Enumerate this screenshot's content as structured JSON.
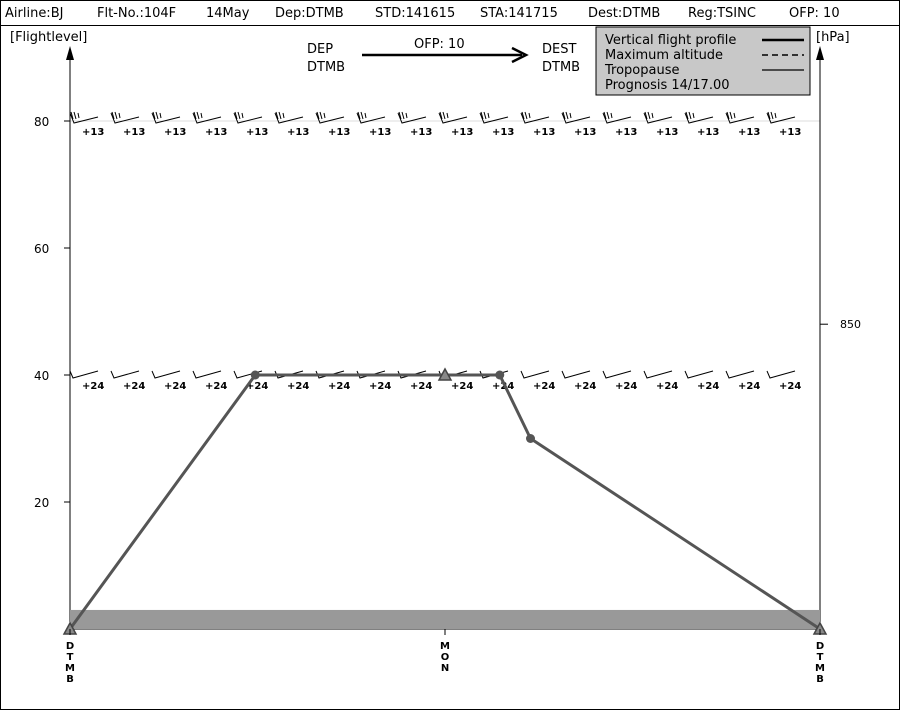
{
  "header": {
    "airline": "Airline:BJ",
    "flight_no": "Flt-No.:104F",
    "date": "14May",
    "dep": "Dep:DTMB",
    "std": "STD:141615",
    "sta": "STA:141715",
    "dest": "Dest:DTMB",
    "reg": "Reg:TSINC",
    "ofp": "OFP: 10"
  },
  "route": {
    "dep_label": "DEP",
    "dep_code": "DTMB",
    "ofp": "OFP: 10",
    "dest_label": "DEST",
    "dest_code": "DTMB"
  },
  "legend": {
    "items": [
      "Vertical flight profile",
      "Maximum altitude",
      "Tropopause"
    ],
    "prognosis": "Prognosis  14/17.00"
  },
  "chart_data": {
    "type": "line",
    "ylabel": "[Flightlevel]",
    "ylabel_right": "[hPa]",
    "ylim": [
      0,
      80
    ],
    "y_ticks": [
      20,
      40,
      60,
      80
    ],
    "pressure_ticks": [
      {
        "level": 48,
        "label": "850"
      }
    ],
    "x_waypoints": [
      {
        "x": 0,
        "label": "DTMB"
      },
      {
        "x": 0.5,
        "label": "MON"
      },
      {
        "x": 1,
        "label": "DTMB"
      }
    ],
    "profile": [
      {
        "x": 0,
        "y": 0,
        "marker": "triangle"
      },
      {
        "x": 0.247,
        "y": 40,
        "marker": "circle"
      },
      {
        "x": 0.5,
        "y": 40,
        "marker": "triangle"
      },
      {
        "x": 0.573,
        "y": 40,
        "marker": "circle"
      },
      {
        "x": 0.614,
        "y": 30,
        "marker": "circle"
      },
      {
        "x": 1,
        "y": 0,
        "marker": "triangle"
      }
    ],
    "terrain_level": 3,
    "wind_rows": [
      {
        "level": 80,
        "temperature": "+13",
        "count": 18
      },
      {
        "level": 40,
        "temperature": "+24",
        "count": 18
      }
    ]
  }
}
